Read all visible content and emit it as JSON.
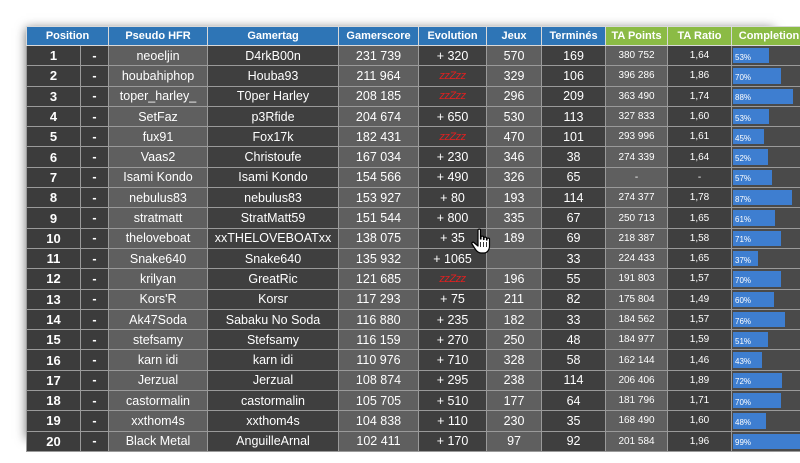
{
  "headers": {
    "position": "Position",
    "pseudo": "Pseudo HFR",
    "gamertag": "Gamertag",
    "gamerscore": "Gamerscore",
    "evolution": "Evolution",
    "jeux": "Jeux",
    "termines": "Terminés",
    "ta_points": "TA Points",
    "ta_ratio": "TA Ratio",
    "completion": "Completion"
  },
  "colors": {
    "header_blue": "#2e75b6",
    "header_green": "#8bbb45",
    "bar_blue": "#3e7ed0",
    "zzz_red": "#e02020"
  },
  "rows": [
    {
      "position": "1",
      "dash": "-",
      "pseudo": "neoeljin",
      "gamertag": "D4rkB00n",
      "gamerscore": "231 739",
      "evolution": "+ 320",
      "jeux": "570",
      "termines": "169",
      "ta_points": "380 752",
      "ta_ratio": "1,64",
      "completion": "53%",
      "completion_value": 53
    },
    {
      "position": "2",
      "dash": "-",
      "pseudo": "houbahiphop",
      "gamertag": "Houba93",
      "gamerscore": "211 964",
      "evolution": "zzZzz",
      "jeux": "329",
      "termines": "106",
      "ta_points": "396 286",
      "ta_ratio": "1,86",
      "completion": "70%",
      "completion_value": 70
    },
    {
      "position": "3",
      "dash": "-",
      "pseudo": "toper_harley_",
      "gamertag": "T0per Harley",
      "gamerscore": "208 185",
      "evolution": "zzZzz",
      "jeux": "296",
      "termines": "209",
      "ta_points": "363 490",
      "ta_ratio": "1,74",
      "completion": "88%",
      "completion_value": 88
    },
    {
      "position": "4",
      "dash": "-",
      "pseudo": "SetFaz",
      "gamertag": "p3Rfide",
      "gamerscore": "204 674",
      "evolution": "+ 650",
      "jeux": "530",
      "termines": "113",
      "ta_points": "327 833",
      "ta_ratio": "1,60",
      "completion": "53%",
      "completion_value": 53
    },
    {
      "position": "5",
      "dash": "-",
      "pseudo": "fux91",
      "gamertag": "Fox17k",
      "gamerscore": "182 431",
      "evolution": "zzZzz",
      "jeux": "470",
      "termines": "101",
      "ta_points": "293 996",
      "ta_ratio": "1,61",
      "completion": "45%",
      "completion_value": 45
    },
    {
      "position": "6",
      "dash": "-",
      "pseudo": "Vaas2",
      "gamertag": "Christoufe",
      "gamerscore": "167 034",
      "evolution": "+ 230",
      "jeux": "346",
      "termines": "38",
      "ta_points": "274 339",
      "ta_ratio": "1,64",
      "completion": "52%",
      "completion_value": 52
    },
    {
      "position": "7",
      "dash": "-",
      "pseudo": "Isami Kondo",
      "gamertag": "Isami Kondo",
      "gamerscore": "154 566",
      "evolution": "+ 490",
      "jeux": "326",
      "termines": "65",
      "ta_points": "-",
      "ta_ratio": "-",
      "completion": "57%",
      "completion_value": 57
    },
    {
      "position": "8",
      "dash": "-",
      "pseudo": "nebulus83",
      "gamertag": "nebulus83",
      "gamerscore": "153 927",
      "evolution": "+ 80",
      "jeux": "193",
      "termines": "114",
      "ta_points": "274 377",
      "ta_ratio": "1,78",
      "completion": "87%",
      "completion_value": 87
    },
    {
      "position": "9",
      "dash": "-",
      "pseudo": "stratmatt",
      "gamertag": "StratMatt59",
      "gamerscore": "151 544",
      "evolution": "+ 800",
      "jeux": "335",
      "termines": "67",
      "ta_points": "250 713",
      "ta_ratio": "1,65",
      "completion": "61%",
      "completion_value": 61
    },
    {
      "position": "10",
      "dash": "-",
      "pseudo": "theloveboat",
      "gamertag": "xxTHELOVEBOATxx",
      "gamerscore": "138 075",
      "evolution": "+ 35",
      "jeux": "189",
      "termines": "69",
      "ta_points": "218 387",
      "ta_ratio": "1,58",
      "completion": "71%",
      "completion_value": 71
    },
    {
      "position": "11",
      "dash": "-",
      "pseudo": "Snake640",
      "gamertag": "Snake640",
      "gamerscore": "135 932",
      "evolution": "+ 1065",
      "jeux": "",
      "termines": "33",
      "ta_points": "224 433",
      "ta_ratio": "1,65",
      "completion": "37%",
      "completion_value": 37
    },
    {
      "position": "12",
      "dash": "-",
      "pseudo": "krilyan",
      "gamertag": "GreatRic",
      "gamerscore": "121 685",
      "evolution": "zzZzz",
      "jeux": "196",
      "termines": "55",
      "ta_points": "191 803",
      "ta_ratio": "1,57",
      "completion": "70%",
      "completion_value": 70
    },
    {
      "position": "13",
      "dash": "-",
      "pseudo": "Kors'R",
      "gamertag": "Korsr",
      "gamerscore": "117 293",
      "evolution": "+ 75",
      "jeux": "211",
      "termines": "82",
      "ta_points": "175 804",
      "ta_ratio": "1,49",
      "completion": "60%",
      "completion_value": 60
    },
    {
      "position": "14",
      "dash": "-",
      "pseudo": "Ak47Soda",
      "gamertag": "Sabaku No Soda",
      "gamerscore": "116 880",
      "evolution": "+ 235",
      "jeux": "182",
      "termines": "33",
      "ta_points": "184 562",
      "ta_ratio": "1,57",
      "completion": "76%",
      "completion_value": 76
    },
    {
      "position": "15",
      "dash": "-",
      "pseudo": "stefsamy",
      "gamertag": "Stefsamy",
      "gamerscore": "116 159",
      "evolution": "+ 270",
      "jeux": "250",
      "termines": "48",
      "ta_points": "184 977",
      "ta_ratio": "1,59",
      "completion": "51%",
      "completion_value": 51
    },
    {
      "position": "16",
      "dash": "-",
      "pseudo": "karn idi",
      "gamertag": "karn idi",
      "gamerscore": "110 976",
      "evolution": "+ 710",
      "jeux": "328",
      "termines": "58",
      "ta_points": "162 144",
      "ta_ratio": "1,46",
      "completion": "43%",
      "completion_value": 43
    },
    {
      "position": "17",
      "dash": "-",
      "pseudo": "Jerzual",
      "gamertag": "Jerzual",
      "gamerscore": "108 874",
      "evolution": "+ 295",
      "jeux": "238",
      "termines": "114",
      "ta_points": "206 406",
      "ta_ratio": "1,89",
      "completion": "72%",
      "completion_value": 72
    },
    {
      "position": "18",
      "dash": "-",
      "pseudo": "castormalin",
      "gamertag": "castormalin",
      "gamerscore": "105 705",
      "evolution": "+ 510",
      "jeux": "177",
      "termines": "64",
      "ta_points": "181 796",
      "ta_ratio": "1,71",
      "completion": "70%",
      "completion_value": 70
    },
    {
      "position": "19",
      "dash": "-",
      "pseudo": "xxthom4s",
      "gamertag": "xxthom4s",
      "gamerscore": "104 838",
      "evolution": "+ 110",
      "jeux": "230",
      "termines": "35",
      "ta_points": "168 490",
      "ta_ratio": "1,60",
      "completion": "48%",
      "completion_value": 48
    },
    {
      "position": "20",
      "dash": "-",
      "pseudo": "Black Metal",
      "gamertag": "AnguilleArnal",
      "gamerscore": "102 411",
      "evolution": "+ 170",
      "jeux": "97",
      "termines": "92",
      "ta_points": "201 584",
      "ta_ratio": "1,96",
      "completion": "99%",
      "completion_value": 99
    }
  ]
}
